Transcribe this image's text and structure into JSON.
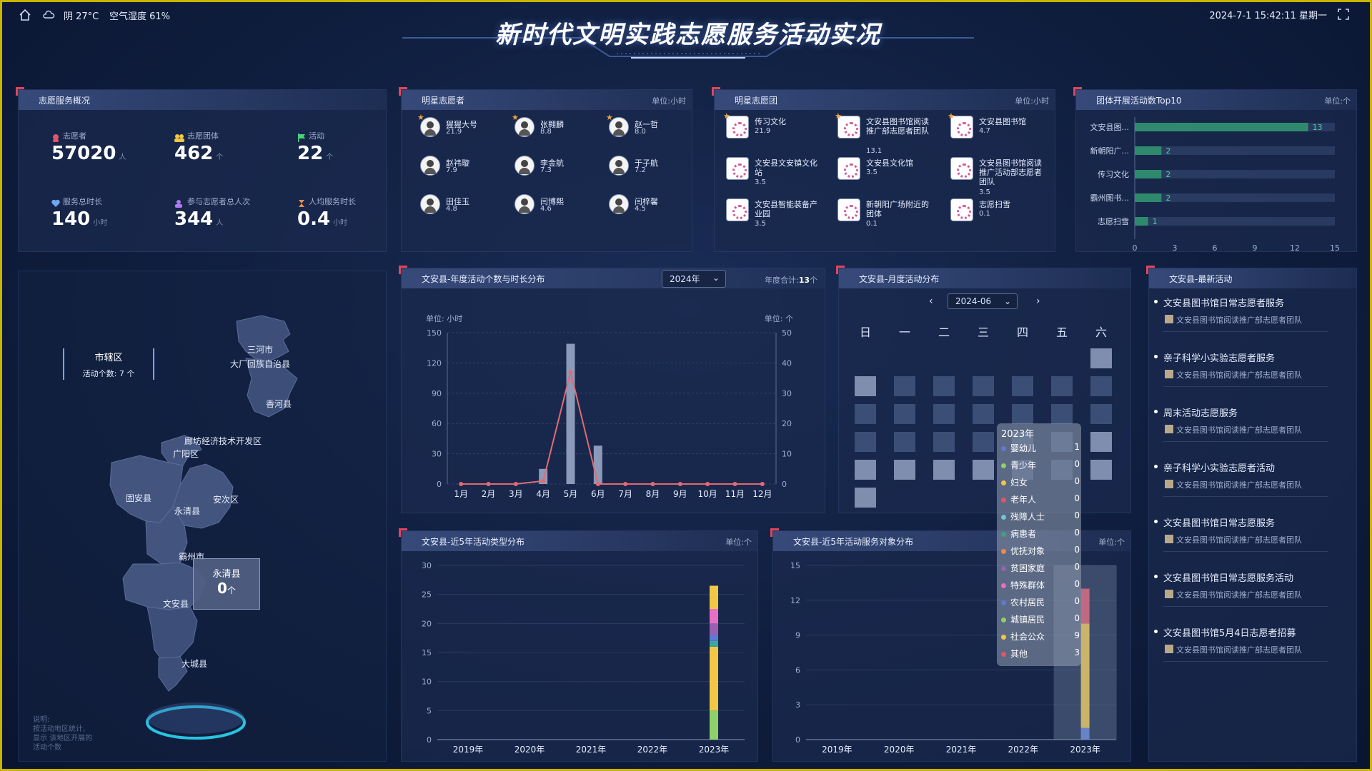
{
  "header": {
    "title": "新时代文明实践志愿服务活动实况",
    "weather": "阴 27°C",
    "humidity": "空气湿度 61%",
    "datetime": "2024-7-1 15:42:11 星期一"
  },
  "overview": {
    "title": "志愿服务概况",
    "stats": [
      {
        "label": "志愿者",
        "value": "57020",
        "unit": "人"
      },
      {
        "label": "志愿团体",
        "value": "462",
        "unit": "个"
      },
      {
        "label": "活动",
        "value": "22",
        "unit": "个"
      },
      {
        "label": "服务总时长",
        "value": "140",
        "unit": "小时"
      },
      {
        "label": "参与志愿者总人次",
        "value": "344",
        "unit": "人"
      },
      {
        "label": "人均服务时长",
        "value": "0.4",
        "unit": "小时"
      }
    ]
  },
  "star_volunteers": {
    "title": "明星志愿者",
    "unit": "单位:小时",
    "people": [
      {
        "name": "猩猩大号",
        "value": "21.9"
      },
      {
        "name": "张翱麟",
        "value": "8.8"
      },
      {
        "name": "赵一哲",
        "value": "8.0"
      },
      {
        "name": "赵祎璇",
        "value": "7.9"
      },
      {
        "name": "李金航",
        "value": "7.3"
      },
      {
        "name": "于子航",
        "value": "7.2"
      },
      {
        "name": "田佳玉",
        "value": "4.8"
      },
      {
        "name": "闫博熙",
        "value": "4.6"
      },
      {
        "name": "闫梓馨",
        "value": "4.5"
      }
    ]
  },
  "star_teams": {
    "title": "明星志愿团",
    "unit": "单位:小时",
    "teams": [
      {
        "name": "传习文化",
        "value": "21.9"
      },
      {
        "name": "文安县图书馆阅读推广部志愿者团队",
        "value": "13.1"
      },
      {
        "name": "文安县图书馆",
        "value": "4.7"
      },
      {
        "name": "文安县文安镇文化站",
        "value": "3.5"
      },
      {
        "name": "文安县文化馆",
        "value": "3.5"
      },
      {
        "name": "文安县图书馆阅读推广活动部志愿者团队",
        "value": "3.5"
      },
      {
        "name": "文安县智能装备产业园",
        "value": "3.5"
      },
      {
        "name": "新朝阳广场附近的团体",
        "value": "0.1"
      },
      {
        "name": "志愿扫雪",
        "value": "0.1"
      }
    ]
  },
  "top10": {
    "title": "团体开展活动数Top10",
    "unit": "单位:个",
    "items": [
      {
        "name": "文安县图...",
        "value": 13
      },
      {
        "name": "新朝阳广...",
        "value": 2
      },
      {
        "name": "传习文化",
        "value": 2
      },
      {
        "name": "霸州图书...",
        "value": 2
      },
      {
        "name": "志愿扫雪",
        "value": 1
      }
    ],
    "ticks": [
      "0",
      "3",
      "6",
      "9",
      "12",
      "15"
    ],
    "max": 15
  },
  "map": {
    "tag_title": "市辖区",
    "tag_sub": "活动个数: 7 个",
    "hover_name": "永清县",
    "hover_value": "0",
    "hover_unit": "个",
    "labels": [
      "三河市",
      "大厂回族自治县",
      "香河县",
      "廊坊经济技术开发区",
      "广阳区",
      "固安县",
      "永清县",
      "安次区",
      "霸州市",
      "文安县",
      "大城县"
    ],
    "note": "说明:\n按活动地区统计,\n显示 该地区开展的\n活动个数"
  },
  "annual": {
    "title": "文安县-年度活动个数与时长分布",
    "year_select": "2024年",
    "total_label": "年度合计:",
    "total_value": "13",
    "total_unit": "个",
    "left_unit": "单位: 小时",
    "right_unit": "单位: 个"
  },
  "monthly": {
    "title": "文安县-月度活动分布",
    "month_select": "2024-06",
    "weekdays": [
      "日",
      "一",
      "二",
      "三",
      "四",
      "五",
      "六"
    ]
  },
  "latest": {
    "title": "文安县-最新活动",
    "items": [
      {
        "title": "文安县图书馆日常志愿者服务",
        "org": "文安县图书馆阅读推广部志愿者团队"
      },
      {
        "title": "亲子科学小实验志愿者服务",
        "org": "文安县图书馆阅读推广部志愿者团队"
      },
      {
        "title": "周末活动志愿服务",
        "org": "文安县图书馆阅读推广部志愿者团队"
      },
      {
        "title": "亲子科学小实验志愿者活动",
        "org": "文安县图书馆阅读推广部志愿者团队"
      },
      {
        "title": "文安县图书馆日常志愿服务",
        "org": "文安县图书馆阅读推广部志愿者团队"
      },
      {
        "title": "文安县图书馆日常志愿服务活动",
        "org": "文安县图书馆阅读推广部志愿者团队"
      },
      {
        "title": "文安县图书馆5月4日志愿者招募",
        "org": "文安县图书馆阅读推广部志愿者团队"
      }
    ]
  },
  "type_dist": {
    "title": "文安县-近5年活动类型分布",
    "unit": "单位:个"
  },
  "target_dist": {
    "title": "文安县-近5年活动服务对象分布",
    "unit": "单位:个",
    "tooltip_title": "2023年",
    "tooltip": [
      {
        "name": "婴幼儿",
        "value": "1",
        "color": "#5b7bd6"
      },
      {
        "name": "青少年",
        "value": "0",
        "color": "#8fd06a"
      },
      {
        "name": "妇女",
        "value": "0",
        "color": "#f2c744"
      },
      {
        "name": "老年人",
        "value": "0",
        "color": "#e3546a"
      },
      {
        "name": "残障人士",
        "value": "0",
        "color": "#6ec3de"
      },
      {
        "name": "病患者",
        "value": "0",
        "color": "#3aa77a"
      },
      {
        "name": "优抚对象",
        "value": "0",
        "color": "#f08a4b"
      },
      {
        "name": "贫困家庭",
        "value": "0",
        "color": "#9a60b4"
      },
      {
        "name": "特殊群体",
        "value": "0",
        "color": "#e86fc6"
      },
      {
        "name": "农村居民",
        "value": "0",
        "color": "#5b7bd6"
      },
      {
        "name": "城镇居民",
        "value": "0",
        "color": "#8fd06a"
      },
      {
        "name": "社会公众",
        "value": "9",
        "color": "#f2c744"
      },
      {
        "name": "其他",
        "value": "3",
        "color": "#e3546a"
      }
    ]
  },
  "chart_data": [
    {
      "type": "bar",
      "title": "文安县-年度活动个数与时长分布",
      "categories": [
        "1月",
        "2月",
        "3月",
        "4月",
        "5月",
        "6月",
        "7月",
        "8月",
        "9月",
        "10月",
        "11月",
        "12月"
      ],
      "series": [
        {
          "values": [
            0,
            0,
            0,
            15,
            139,
            38,
            0,
            0,
            0,
            0,
            0,
            0
          ]
        },
        {
          "values": [
            0,
            0,
            0,
            1,
            37,
            0,
            0,
            0,
            0,
            0,
            0,
            0
          ]
        }
      ],
      "ylim": [
        0,
        150
      ],
      "y2lim": [
        0,
        50
      ],
      "yticks": [
        "0",
        "30",
        "60",
        "90",
        "120",
        "150"
      ],
      "y2ticks": [
        "0",
        "10",
        "20",
        "30",
        "40",
        "50"
      ]
    },
    {
      "type": "bar",
      "title": "文安县-近5年活动类型分布",
      "categories": [
        "2019年",
        "2020年",
        "2021年",
        "2022年",
        "2023年"
      ],
      "stack_2023": [
        {
          "value": 5,
          "color": "#8fd06a"
        },
        {
          "value": 11,
          "color": "#f2c744"
        },
        {
          "value": 1,
          "color": "#3aa7a0"
        },
        {
          "value": 1,
          "color": "#5b7bd6"
        },
        {
          "value": 2,
          "color": "#9a60b4"
        },
        {
          "value": 2.5,
          "color": "#e86fc6"
        },
        {
          "value": 4,
          "color": "#f2c744"
        }
      ],
      "ylim": [
        0,
        30
      ],
      "yticks": [
        "0",
        "5",
        "10",
        "15",
        "20",
        "25",
        "30"
      ]
    },
    {
      "type": "bar",
      "title": "文安县-近5年活动服务对象分布",
      "categories": [
        "2019年",
        "2020年",
        "2021年",
        "2022年",
        "2023年"
      ],
      "stack_2023": [
        {
          "value": 1,
          "color": "#5b7bd6"
        },
        {
          "value": 9,
          "color": "#f2c744"
        },
        {
          "value": 3,
          "color": "#e3546a"
        }
      ],
      "ylim": [
        0,
        15
      ],
      "yticks": [
        "0",
        "3",
        "6",
        "9",
        "12",
        "15"
      ]
    }
  ]
}
